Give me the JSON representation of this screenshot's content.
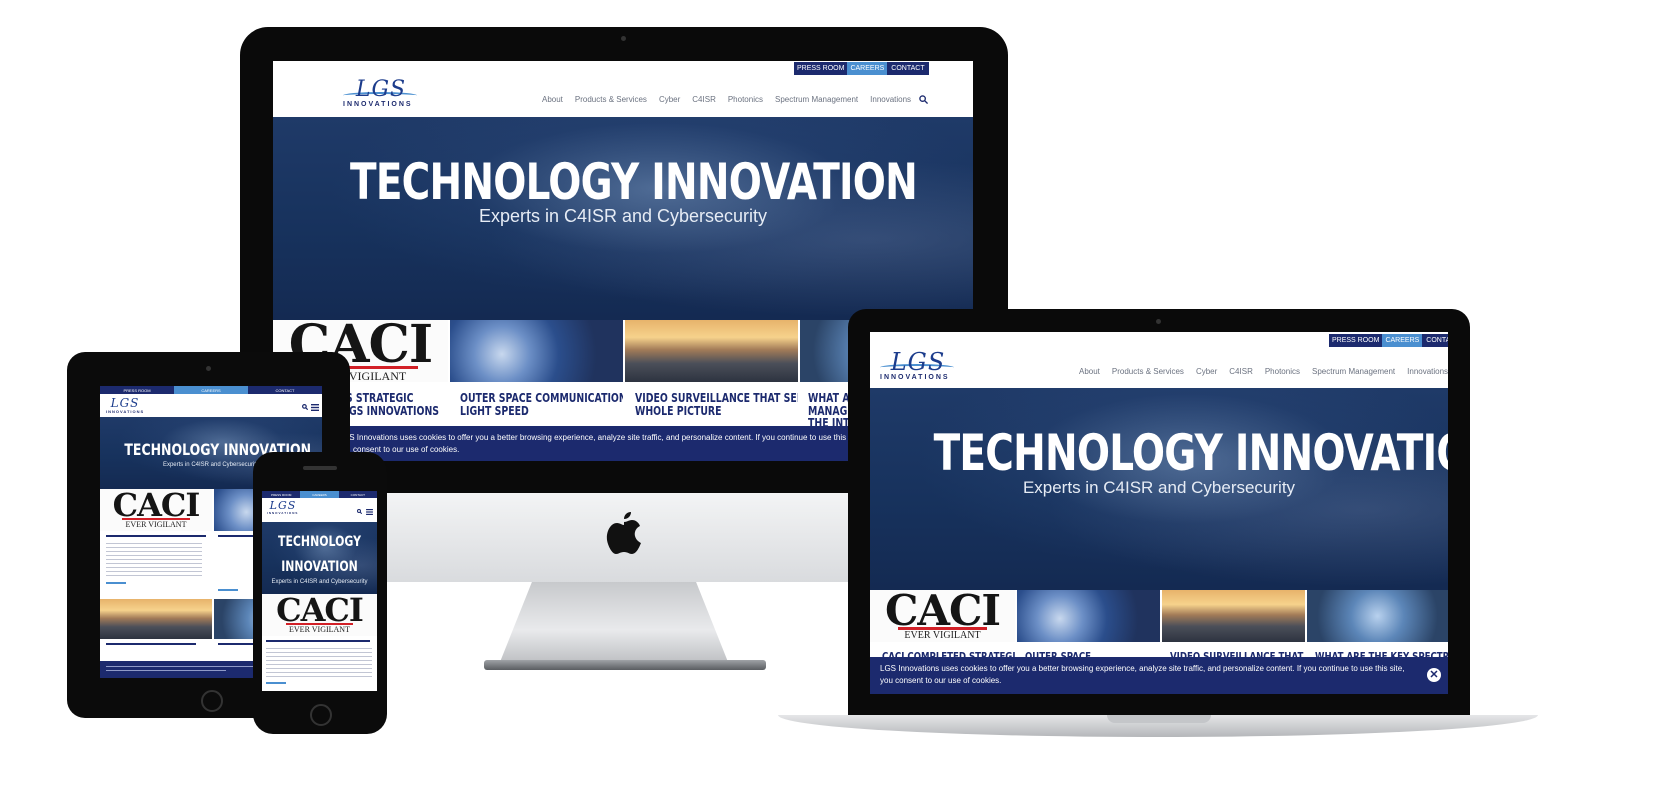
{
  "site": {
    "utility_nav": [
      "PRESS ROOM",
      "CAREERS",
      "CONTACT"
    ],
    "logo": {
      "mark": "LGS",
      "sub": "INNOVATIONS"
    },
    "main_nav": [
      "About",
      "Products & Services",
      "Cyber",
      "C4ISR",
      "Photonics",
      "Spectrum Management",
      "Innovations"
    ],
    "hero": {
      "title": "TECHNOLOGY INNOVATION",
      "subtitle": "Experts in C4ISR and Cybersecurity"
    },
    "cards": [
      {
        "image": "caci-logo",
        "title_line1": "CACI COMPLETES STRATEGIC",
        "title_line2": "ACQUISITION OF LGS INNOVATIONS"
      },
      {
        "image": "globe-touch",
        "title_line1": "OUTER SPACE COMMUNICATIONS—AT",
        "title_line2": "LIGHT SPEED"
      },
      {
        "image": "highway-sunset",
        "title_line1": "VIDEO SURVEILLANCE THAT SEES THE",
        "title_line2": "WHOLE PICTURE"
      },
      {
        "image": "tech-hand",
        "title_line1": "WHAT ARE THE KEY SPECTRUM",
        "title_line2": "MANAGEMENT"
      }
    ],
    "caci_logo": {
      "word": "CACI",
      "tagline": "EVER VIGILANT"
    },
    "cookie": {
      "line1": "LGS Innovations uses cookies to offer you a better browsing experience, analyze site traffic, and personalize content. If you continue to use this site,",
      "line2": "you consent to our use of cookies.",
      "close_icon": "close-icon"
    },
    "icons": {
      "search": "search-icon",
      "menu": "hamburger-menu-icon"
    }
  },
  "imac": {
    "card_titles": [
      {
        "line1": "'S STRATEGIC",
        "line2": "LGS INNOVATIONS"
      },
      {
        "line1": "OUTER SPACE COMMUNICATIONS—AT",
        "line2": "LIGHT SPEED"
      },
      {
        "line1": "VIDEO SURVEILLANCE THAT SEES THE",
        "line2": "WHOLE PICTURE"
      },
      {
        "line1": "WHAT AR",
        "line2": "MANAGEM",
        "line3": "THE INTE"
      }
    ],
    "cookie_line1": "GS Innovations uses cookies to offer you a better browsing experience, analyze site traffic, and personalize content. If you continue to use this site,",
    "cookie_line2": "consent to our use of cookies."
  },
  "macbook": {
    "card_titles": [
      {
        "line1": "CACI COMPLETED STRATEGIC"
      },
      {
        "line1": "OUTER SPACE"
      },
      {
        "line1": "VIDEO SURVEILLANCE THAT"
      },
      {
        "line1": "WHAT ARE THE KEY SPECTRUM"
      }
    ]
  },
  "tablet": {
    "hero_title": "TECHNOLOGY INNOVATION",
    "hero_subtitle": "Experts in C4ISR and Cybersecurity"
  },
  "phone": {
    "hero_title_line1": "TECHNOLOGY",
    "hero_title_line2": "INNOVATION",
    "hero_subtitle": "Experts in C4ISR and Cybersecurity"
  },
  "colors": {
    "navy": "#1c2a6e",
    "accent_blue": "#4a8fd0",
    "hero_blue": "#17325d",
    "caci_red": "#d22027"
  }
}
